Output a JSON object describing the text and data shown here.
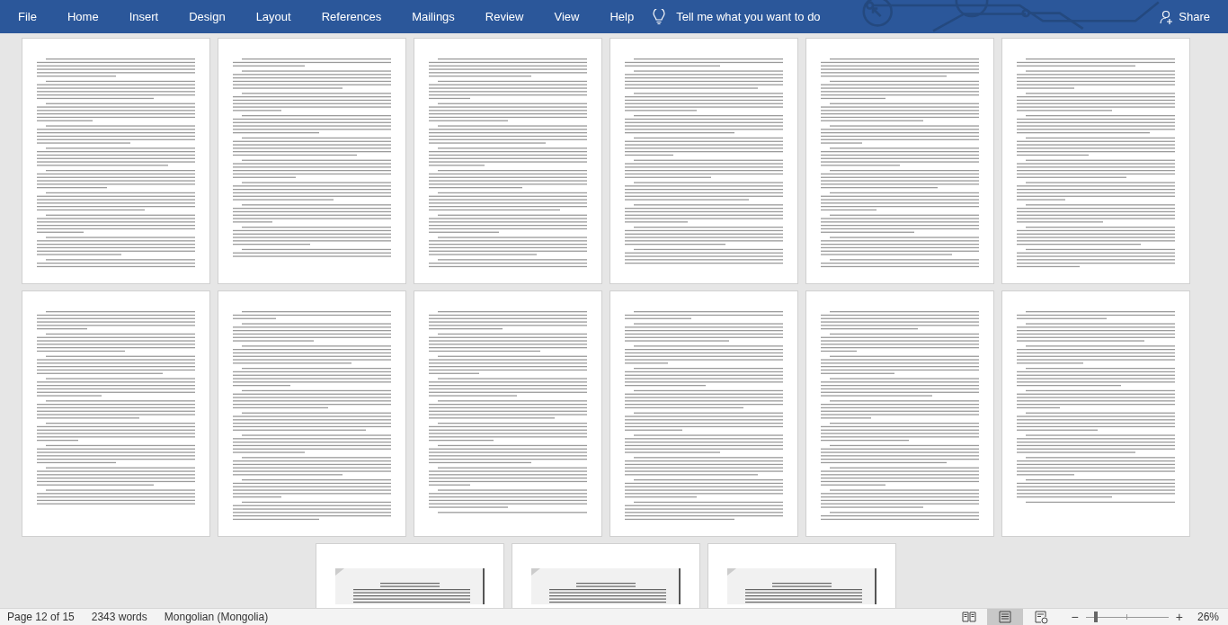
{
  "ribbon": {
    "tabs": [
      {
        "label": "File"
      },
      {
        "label": "Home"
      },
      {
        "label": "Insert"
      },
      {
        "label": "Design"
      },
      {
        "label": "Layout"
      },
      {
        "label": "References"
      },
      {
        "label": "Mailings"
      },
      {
        "label": "Review"
      },
      {
        "label": "View"
      },
      {
        "label": "Help"
      }
    ],
    "tell_me": "Tell me what you want to do",
    "share": "Share"
  },
  "document": {
    "rows": [
      {
        "pages": [
          {
            "kind": "text"
          },
          {
            "kind": "text"
          },
          {
            "kind": "text"
          },
          {
            "kind": "text"
          },
          {
            "kind": "text"
          },
          {
            "kind": "text"
          }
        ]
      },
      {
        "pages": [
          {
            "kind": "text"
          },
          {
            "kind": "text"
          },
          {
            "kind": "text"
          },
          {
            "kind": "text"
          },
          {
            "kind": "text"
          },
          {
            "kind": "text"
          }
        ]
      },
      {
        "pages": [
          {
            "kind": "scan"
          },
          {
            "kind": "scan"
          },
          {
            "kind": "scan"
          }
        ]
      }
    ]
  },
  "status_bar": {
    "page": "Page 12 of 15",
    "words": "2343 words",
    "language": "Mongolian (Mongolia)",
    "views": [
      {
        "kind": "read",
        "selected": false
      },
      {
        "kind": "print",
        "selected": true
      },
      {
        "kind": "web",
        "selected": false
      }
    ],
    "zoom": {
      "minus": "−",
      "plus": "+",
      "level": 0.11,
      "reading": "26%"
    }
  }
}
